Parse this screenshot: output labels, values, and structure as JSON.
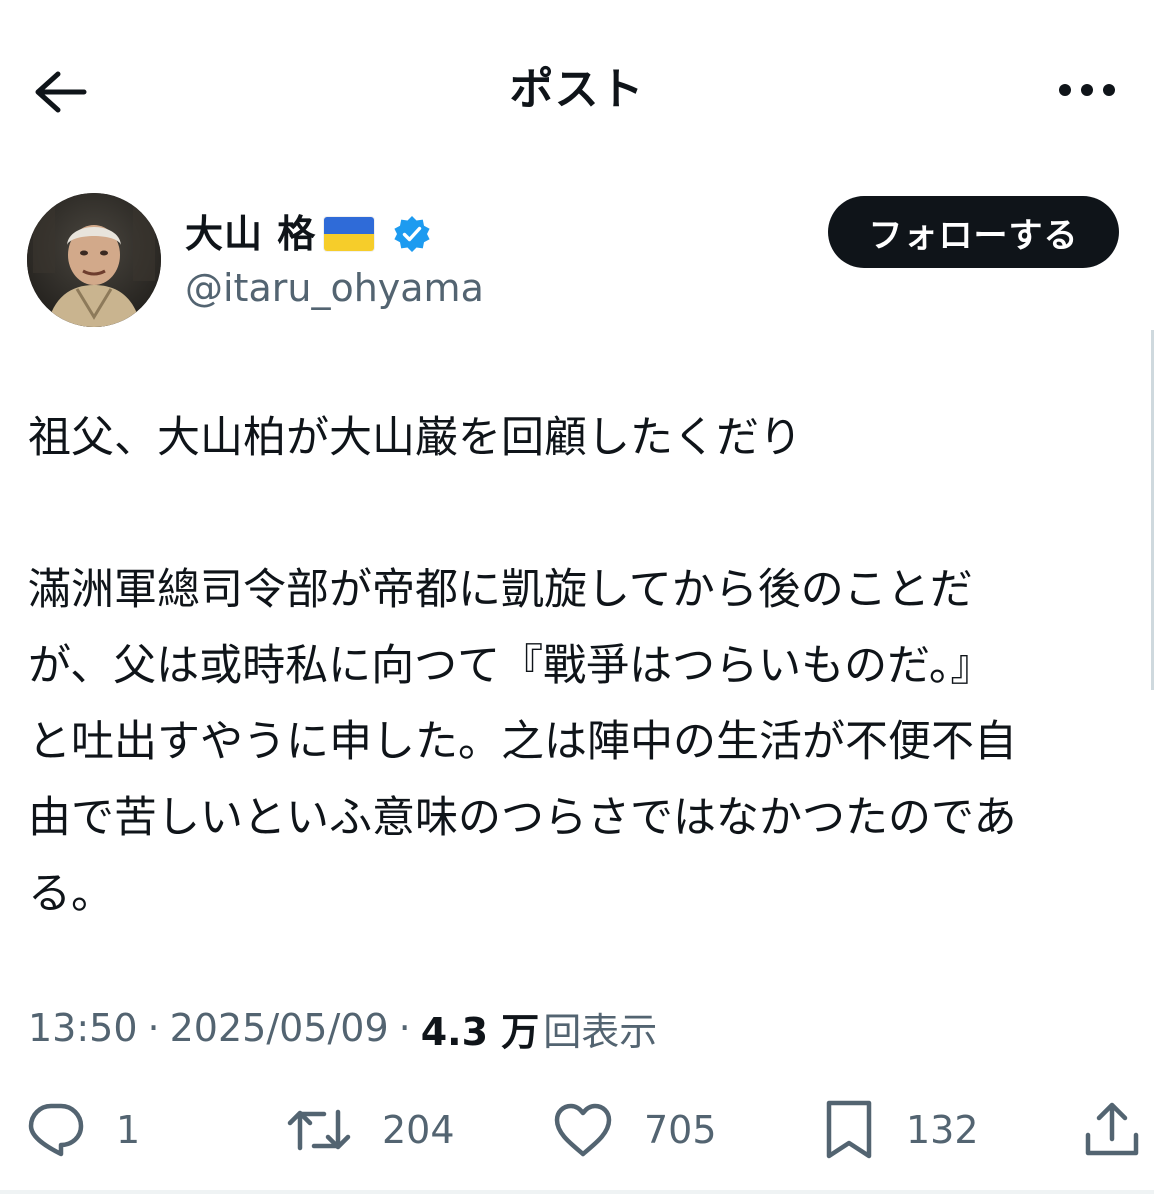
{
  "header": {
    "title": "ポスト",
    "back_icon": "arrow-left-icon",
    "more_icon": "more-horizontal-icon"
  },
  "author": {
    "display_name": "大山 格",
    "flag_icon": "ukraine-flag-icon",
    "verified_icon": "verified-badge-icon",
    "handle": "@itaru_ohyama",
    "follow_label": "フォローする"
  },
  "tweet": {
    "line1": "祖父、大山柏が大山巌を回顧したくだり",
    "line2": "滿洲軍總司令部が帝都に凱旋してから後のことだ",
    "line3": "が、父は或時私に向つて『戰爭はつらいものだ。』",
    "line4": "と吐出すやうに申した。之は陣中の生活が不便不自",
    "line5": "由で苦しいといふ意味のつらさではなかつたのであ",
    "line6": "る。"
  },
  "meta": {
    "time": "13:50",
    "separator": "·",
    "date": "2025/05/09",
    "views_count": "4.3 万",
    "views_label": "回表示"
  },
  "actions": {
    "reply_count": "1",
    "repost_count": "204",
    "like_count": "705",
    "bookmark_count": "132"
  },
  "colors": {
    "text_primary": "#0f1419",
    "text_secondary": "#536471",
    "verified_blue": "#1d9bf0",
    "flag_blue": "#2f6bd8",
    "flag_yellow": "#f6cd2a"
  }
}
